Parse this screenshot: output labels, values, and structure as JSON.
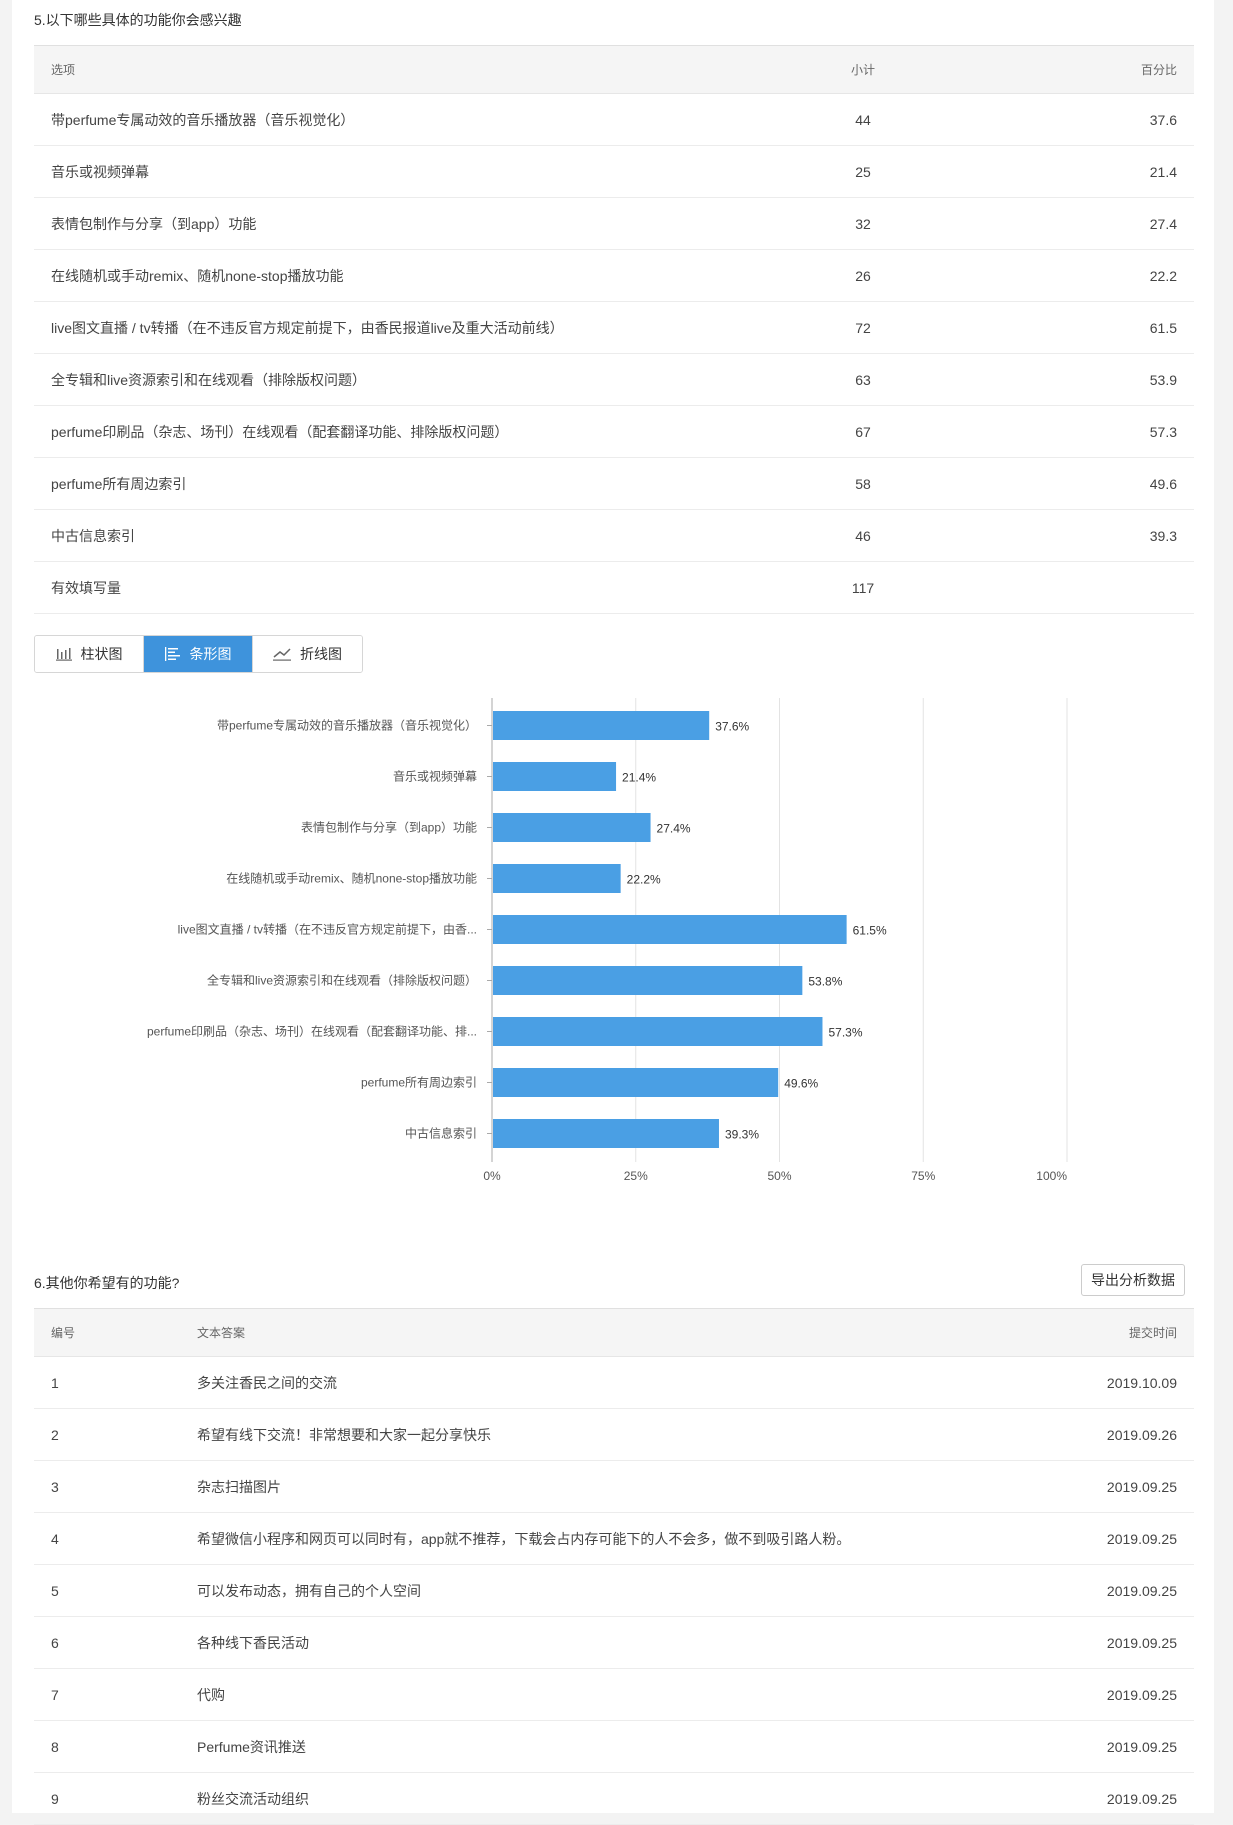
{
  "q5": {
    "title": "5.以下哪些具体的功能你会感兴趣",
    "headers": {
      "option": "选项",
      "count": "小计",
      "percent": "百分比"
    },
    "rows": [
      {
        "option": "带perfume专属动效的音乐播放器（音乐视觉化）",
        "count": "44",
        "percent": "37.6"
      },
      {
        "option": "音乐或视频弹幕",
        "count": "25",
        "percent": "21.4"
      },
      {
        "option": "表情包制作与分享（到app）功能",
        "count": "32",
        "percent": "27.4"
      },
      {
        "option": "在线随机或手动remix、随机none-stop播放功能",
        "count": "26",
        "percent": "22.2"
      },
      {
        "option": "live图文直播 / tv转播（在不违反官方规定前提下，由香民报道live及重大活动前线）",
        "count": "72",
        "percent": "61.5"
      },
      {
        "option": "全专辑和live资源索引和在线观看（排除版权问题）",
        "count": "63",
        "percent": "53.9"
      },
      {
        "option": "perfume印刷品（杂志、场刊）在线观看（配套翻译功能、排除版权问题）",
        "count": "67",
        "percent": "57.3"
      },
      {
        "option": "perfume所有周边索引",
        "count": "58",
        "percent": "49.6"
      },
      {
        "option": "中古信息索引",
        "count": "46",
        "percent": "39.3"
      }
    ],
    "valid": {
      "label": "有效填写量",
      "count": "117"
    },
    "tabs": [
      {
        "label": "柱状图",
        "icon": "bar-chart-icon",
        "active": false
      },
      {
        "label": "条形图",
        "icon": "horizontal-bar-icon",
        "active": true
      },
      {
        "label": "折线图",
        "icon": "line-chart-icon",
        "active": false
      }
    ],
    "accent_color": "#3e93dc",
    "bar_color": "#4a9fe4"
  },
  "chart_data": {
    "type": "bar",
    "orientation": "horizontal",
    "categories": [
      "带perfume专属动效的音乐播放器（音乐视觉化）",
      "音乐或视频弹幕",
      "表情包制作与分享（到app）功能",
      "在线随机或手动remix、随机none-stop播放功能",
      "live图文直播 / tv转播（在不违反官方规定前提下，由香...",
      "全专辑和live资源索引和在线观看（排除版权问题）",
      "perfume印刷品（杂志、场刊）在线观看（配套翻译功能、排...",
      "perfume所有周边索引",
      "中古信息索引"
    ],
    "values": [
      37.6,
      21.4,
      27.4,
      22.2,
      61.5,
      53.8,
      57.3,
      49.6,
      39.3
    ],
    "data_labels": [
      "37.6%",
      "21.4%",
      "27.4%",
      "22.2%",
      "61.5%",
      "53.8%",
      "57.3%",
      "49.6%",
      "39.3%"
    ],
    "xlim": [
      0,
      100
    ],
    "xticks": [
      "0%",
      "25%",
      "50%",
      "75%",
      "100%"
    ],
    "grid": true,
    "title": "",
    "xlabel": "",
    "ylabel": ""
  },
  "q6": {
    "title": "6.其他你希望有的功能?",
    "export_label": "导出分析数据",
    "headers": {
      "id": "编号",
      "answer": "文本答案",
      "time": "提交时间"
    },
    "rows": [
      {
        "id": "1",
        "answer": "多关注香民之间的交流",
        "time": "2019.10.09"
      },
      {
        "id": "2",
        "answer": "希望有线下交流！非常想要和大家一起分享快乐",
        "time": "2019.09.26"
      },
      {
        "id": "3",
        "answer": "杂志扫描图片",
        "time": "2019.09.25"
      },
      {
        "id": "4",
        "answer": "希望微信小程序和网页可以同时有，app就不推荐，下载会占内存可能下的人不会多，做不到吸引路人粉。",
        "time": "2019.09.25"
      },
      {
        "id": "5",
        "answer": "可以发布动态，拥有自己的个人空间",
        "time": "2019.09.25"
      },
      {
        "id": "6",
        "answer": "各种线下香民活动",
        "time": "2019.09.25"
      },
      {
        "id": "7",
        "answer": "代购",
        "time": "2019.09.25"
      },
      {
        "id": "8",
        "answer": "Perfume资讯推送",
        "time": "2019.09.25"
      },
      {
        "id": "9",
        "answer": "粉丝交流活动组织",
        "time": "2019.09.25"
      }
    ]
  }
}
